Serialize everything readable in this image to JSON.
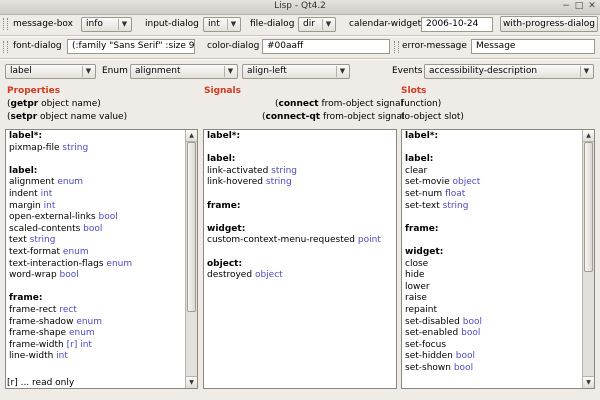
{
  "window": {
    "title": "Lisp - Qt4.2",
    "minimize_glyph": "−",
    "maximize_glyph": "□",
    "close_glyph": "✕"
  },
  "toolbar1": {
    "message_box": {
      "label": "message-box",
      "value": "info"
    },
    "input_dialog": {
      "label": "input-dialog",
      "value": "int"
    },
    "file_dialog": {
      "label": "file-dialog",
      "value": "dir"
    },
    "calendar_widget": {
      "label": "calendar-widget",
      "value": "2006-10-24"
    },
    "with_progress_dialog": {
      "label": "with-progress-dialog"
    }
  },
  "toolbar2": {
    "font_dialog": {
      "label": "font-dialog",
      "value": "(:family \"Sans Serif\" :size 9)"
    },
    "color_dialog": {
      "label": "color-dialog",
      "value": "#00aaff"
    },
    "error_message": {
      "label": "error-message",
      "value": "Message"
    }
  },
  "controls": {
    "class_select": "label",
    "enum_label": "Enum",
    "enum_select": "alignment",
    "enum_value_select": "align-left",
    "events_label": "Events",
    "events_select": "accessibility-description"
  },
  "headers": {
    "properties": "Properties",
    "signals": "Signals",
    "slots": "Slots"
  },
  "help": {
    "getpr": {
      "fn": "getpr",
      "args": " object name)"
    },
    "setpr": {
      "fn": "setpr",
      "args": " object name value)"
    },
    "connect": {
      "fn": "connect",
      "args": " from-object signal",
      "tail": "function)"
    },
    "connect_qt": {
      "fn": "connect-qt",
      "args": " from-object signal",
      "tail": "to-object slot)"
    }
  },
  "properties_list": [
    {
      "name": "label*:",
      "bold": true
    },
    {
      "name": "pixmap-file",
      "type": "string"
    },
    {
      "name": ""
    },
    {
      "name": "label:",
      "bold": true
    },
    {
      "name": "alignment",
      "type": "enum"
    },
    {
      "name": "indent",
      "type": "int"
    },
    {
      "name": "margin",
      "type": "int"
    },
    {
      "name": "open-external-links",
      "type": "bool"
    },
    {
      "name": "scaled-contents",
      "type": "bool"
    },
    {
      "name": "text",
      "type": "string"
    },
    {
      "name": "text-format",
      "type": "enum"
    },
    {
      "name": "text-interaction-flags",
      "type": "enum"
    },
    {
      "name": "word-wrap",
      "type": "bool"
    },
    {
      "name": ""
    },
    {
      "name": "frame:",
      "bold": true
    },
    {
      "name": "frame-rect",
      "type": "rect"
    },
    {
      "name": "frame-shadow",
      "type": "enum"
    },
    {
      "name": "frame-shape",
      "type": "enum"
    },
    {
      "name": "frame-width",
      "type": "[r] int"
    },
    {
      "name": "line-width",
      "type": "int"
    }
  ],
  "signals_list": [
    {
      "name": "label*:",
      "bold": true
    },
    {
      "name": ""
    },
    {
      "name": "label:",
      "bold": true
    },
    {
      "name": "link-activated",
      "type": "string"
    },
    {
      "name": "link-hovered",
      "type": "string"
    },
    {
      "name": ""
    },
    {
      "name": "frame:",
      "bold": true
    },
    {
      "name": ""
    },
    {
      "name": "widget:",
      "bold": true
    },
    {
      "name": "custom-context-menu-requested",
      "type": "point"
    },
    {
      "name": ""
    },
    {
      "name": "object:",
      "bold": true
    },
    {
      "name": "destroyed",
      "type": "object"
    }
  ],
  "slots_list": [
    {
      "name": "label*:",
      "bold": true
    },
    {
      "name": ""
    },
    {
      "name": "label:",
      "bold": true
    },
    {
      "name": "clear"
    },
    {
      "name": "set-movie",
      "type": "object"
    },
    {
      "name": "set-num",
      "type": "float"
    },
    {
      "name": "set-text",
      "type": "string"
    },
    {
      "name": ""
    },
    {
      "name": "frame:",
      "bold": true
    },
    {
      "name": ""
    },
    {
      "name": "widget:",
      "bold": true
    },
    {
      "name": "close"
    },
    {
      "name": "hide"
    },
    {
      "name": "lower"
    },
    {
      "name": "raise"
    },
    {
      "name": "repaint"
    },
    {
      "name": "set-disabled",
      "type": "bool"
    },
    {
      "name": "set-enabled",
      "type": "bool"
    },
    {
      "name": "set-focus"
    },
    {
      "name": "set-hidden",
      "type": "bool"
    },
    {
      "name": "set-shown",
      "type": "bool"
    }
  ],
  "footer": {
    "note": "[r] ... read only"
  },
  "colors": {
    "header": "#d23a1e",
    "type": "#4a4ac4"
  }
}
